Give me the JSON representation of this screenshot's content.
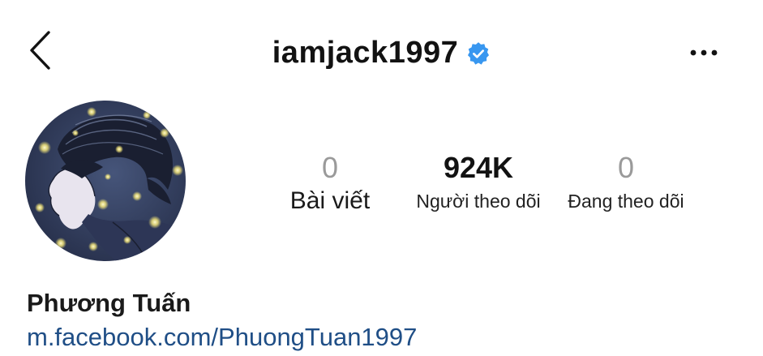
{
  "header": {
    "username": "iamjack1997",
    "verified": true,
    "icons": {
      "back": "chevron-left-icon",
      "verified": "verified-badge-icon",
      "more": "more-horizontal-icon"
    }
  },
  "profile": {
    "avatar": "profile-avatar-illustration",
    "full_name": "Phương Tuấn",
    "link": "m.facebook.com/PhuongTuan1997"
  },
  "stats": {
    "posts": {
      "value": "0",
      "label": "Bài viết"
    },
    "followers": {
      "value": "924K",
      "label": "Người theo dõi"
    },
    "following": {
      "value": "0",
      "label": "Đang theo dõi"
    }
  },
  "colors": {
    "verified_badge": "#3897f0",
    "link": "#1f4e86",
    "muted_number": "#9a9a9a",
    "text": "#121212"
  }
}
